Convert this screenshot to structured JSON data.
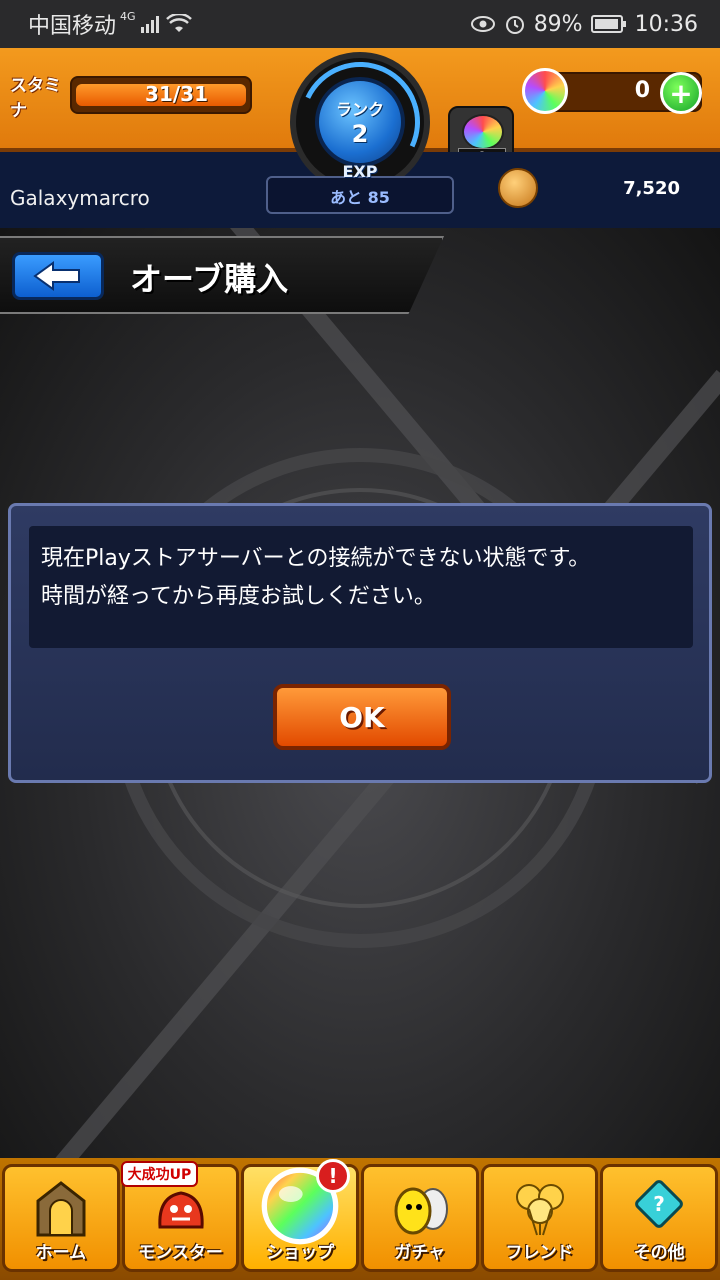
{
  "status_bar": {
    "carrier": "中国移动",
    "network": "4G",
    "battery": "89%",
    "time": "10:36"
  },
  "hud": {
    "stamina_label": "スタミナ",
    "stamina_value": "31/31",
    "stamina_fraction": 1.0,
    "rank_label": "ランク",
    "rank_value": "2",
    "exp_label": "EXP",
    "exp_remaining": "あと 85",
    "gem_count": "0",
    "orb_count": "0",
    "plus_label": "+"
  },
  "player": {
    "name": "Galaxymarcro",
    "coins": "7,520"
  },
  "page": {
    "title": "オーブ購入"
  },
  "dialog": {
    "message_line1": "現在Playストアサーバーとの接続ができない状態です。",
    "message_line2": "時間が経ってから再度お試しください。",
    "ok_label": "OK"
  },
  "nav": {
    "items": [
      {
        "label": "ホーム",
        "icon": "home-gate-icon"
      },
      {
        "label": "モンスター",
        "icon": "monster-icon",
        "badge": "大成功UP"
      },
      {
        "label": "ショップ",
        "icon": "rainbow-orb-icon",
        "alert": "!"
      },
      {
        "label": "ガチャ",
        "icon": "gacha-egg-icon"
      },
      {
        "label": "フレンド",
        "icon": "friend-balloons-icon"
      },
      {
        "label": "その他",
        "icon": "other-menu-icon"
      }
    ]
  },
  "colors": {
    "hud_orange": "#f39a1e",
    "dialog_bg": "#2f3b63",
    "ok_button": "#e24a00",
    "back_button": "#0d5fcf"
  }
}
